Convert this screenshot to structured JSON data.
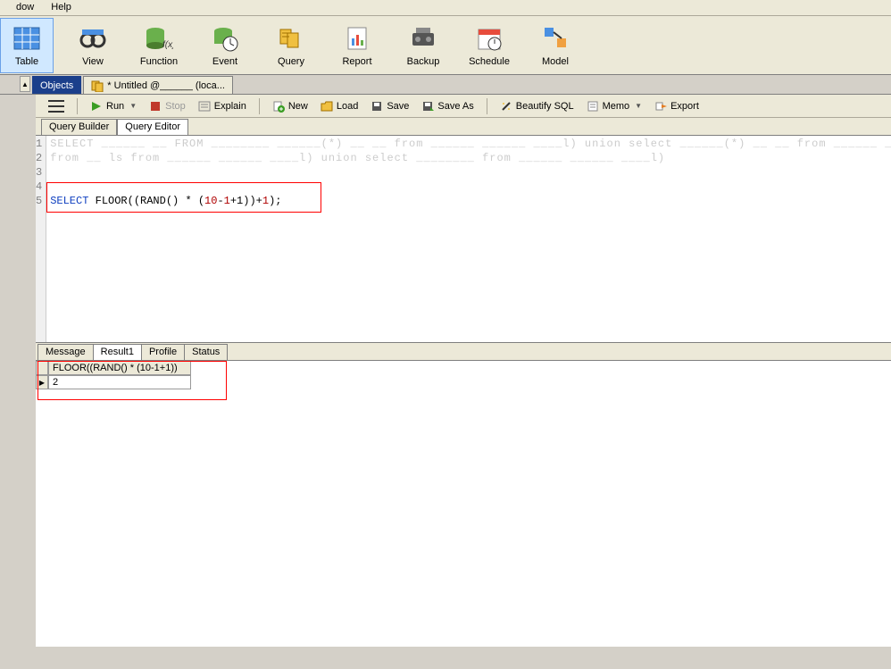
{
  "menu": {
    "window": "dow",
    "help": "Help"
  },
  "toolbar": {
    "table": "Table",
    "view": "View",
    "function": "Function",
    "event": "Event",
    "query": "Query",
    "report": "Report",
    "backup": "Backup",
    "schedule": "Schedule",
    "model": "Model"
  },
  "doctabs": {
    "objects": "Objects",
    "untitled": "* Untitled @______ (loca..."
  },
  "sectoolbar": {
    "run": "Run",
    "stop": "Stop",
    "explain": "Explain",
    "new": "New",
    "load": "Load",
    "save": "Save",
    "saveas": "Save As",
    "beautify": "Beautify SQL",
    "memo": "Memo",
    "export": "Export"
  },
  "subtabs": {
    "builder": "Query Builder",
    "editor": "Query Editor"
  },
  "editor": {
    "lines": [
      "1",
      "2",
      "3",
      "4",
      "5"
    ],
    "blur1": "SELECT ______ __ FROM ________ ______(*) __ __ from ______ ______ ____l) union select ______(*) __ __ from ______ ______ ____l)",
    "blur2": "from __ ls from ______ ______ ____l) union select ________ from ______ ______ ____l)",
    "sqlline": {
      "sel": "SELECT",
      "floor": " FLOOR((RAND() * (",
      "ten": "10",
      "minus": "-",
      "one": "1",
      "plusone": "+1",
      "tail": "))+",
      "one2": "1",
      "end": ");"
    }
  },
  "restabs": {
    "message": "Message",
    "result1": "Result1",
    "profile": "Profile",
    "status": "Status"
  },
  "result": {
    "header": "FLOOR((RAND() * (10-1+1))",
    "value": "2"
  }
}
